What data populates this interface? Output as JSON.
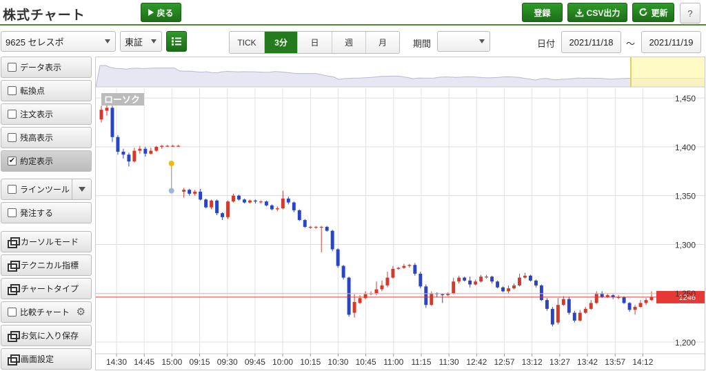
{
  "app": {
    "title": "株式チャート"
  },
  "toolbar": {
    "back_label": "戻る",
    "register_label": "登録",
    "csv_label": "CSV出力",
    "refresh_label": "更新",
    "help_label": "?"
  },
  "controls": {
    "stock_select": "9625 セレスポ",
    "market_select": "東証",
    "timeframes": [
      {
        "label": "TICK",
        "active": false
      },
      {
        "label": "3分",
        "active": true
      },
      {
        "label": "日",
        "active": false
      },
      {
        "label": "週",
        "active": false
      },
      {
        "label": "月",
        "active": false
      }
    ],
    "period_label": "期間",
    "period_value": "",
    "date_label": "日付",
    "date_from": "2021/11/18",
    "date_separator": "～",
    "date_to": "2021/11/19"
  },
  "sidebar": {
    "items": [
      {
        "label": "データ表示",
        "kind": "check",
        "checked": false
      },
      {
        "label": "転換点",
        "kind": "check",
        "checked": false
      },
      {
        "label": "注文表示",
        "kind": "check",
        "checked": false
      },
      {
        "label": "残高表示",
        "kind": "check",
        "checked": false
      },
      {
        "label": "約定表示",
        "kind": "check",
        "checked": true
      },
      {
        "label": "ラインツール",
        "kind": "check-split",
        "checked": false
      },
      {
        "label": "発注する",
        "kind": "check",
        "checked": false
      },
      {
        "label": "カーソルモード",
        "kind": "window"
      },
      {
        "label": "テクニカル指標",
        "kind": "window"
      },
      {
        "label": "チャートタイプ",
        "kind": "window"
      },
      {
        "label": "比較チャート",
        "kind": "check-gear",
        "checked": false
      },
      {
        "label": "お気に入り保存",
        "kind": "window"
      },
      {
        "label": "画面設定",
        "kind": "window"
      }
    ]
  },
  "colors": {
    "accent": "#237b1e",
    "up_candle": "#d33a2c",
    "down_candle": "#2a45c4",
    "price_line": "#e53935",
    "execution_marker": "#f5b800"
  },
  "chart_data": {
    "type": "candlestick",
    "title": "",
    "chart_type_label": "ローソク",
    "current_price_label": "1246",
    "current_price": 1246,
    "ylim": [
      1188,
      1460
    ],
    "y_ticks": [
      "1,450",
      "1,400",
      "1,350",
      "1,300",
      "1,250",
      "1,200"
    ],
    "y_tick_values": [
      1450,
      1400,
      1350,
      1300,
      1250,
      1200
    ],
    "x_ticks": [
      "14:30",
      "14:45",
      "15:00",
      "09:15",
      "09:30",
      "09:45",
      "10:00",
      "10:15",
      "10:30",
      "10:45",
      "11:00",
      "11:15",
      "11:30",
      "12:42",
      "12:57",
      "13:12",
      "13:27",
      "13:42",
      "13:57",
      "14:12"
    ],
    "candles": [
      [
        1428,
        1438,
        1425,
        1442
      ],
      [
        1437,
        1440,
        1432,
        1446
      ],
      [
        1440,
        1410,
        1405,
        1442
      ],
      [
        1410,
        1395,
        1392,
        1412
      ],
      [
        1395,
        1392,
        1388,
        1398
      ],
      [
        1392,
        1385,
        1380,
        1394
      ],
      [
        1385,
        1396,
        1384,
        1399
      ],
      [
        1396,
        1398,
        1393,
        1401
      ],
      [
        1398,
        1393,
        1390,
        1400
      ],
      [
        1393,
        1396,
        1392,
        1399
      ],
      [
        1396,
        1400,
        1395,
        1401
      ],
      [
        1400,
        1401,
        1398,
        1402
      ],
      [
        1401,
        1401,
        1400,
        1402
      ],
      [
        1401,
        1401,
        1400,
        1402
      ],
      [
        1401,
        1401,
        1400,
        1402
      ],
      [
        1354,
        1356,
        1348,
        1358
      ],
      [
        1356,
        1352,
        1350,
        1357
      ],
      [
        1352,
        1354,
        1350,
        1356
      ],
      [
        1354,
        1346,
        1345,
        1357
      ],
      [
        1346,
        1338,
        1337,
        1347
      ],
      [
        1338,
        1345,
        1336,
        1346
      ],
      [
        1345,
        1332,
        1330,
        1346
      ],
      [
        1332,
        1328,
        1325,
        1333
      ],
      [
        1328,
        1344,
        1326,
        1345
      ],
      [
        1344,
        1350,
        1343,
        1352
      ],
      [
        1350,
        1346,
        1345,
        1351
      ],
      [
        1346,
        1343,
        1342,
        1347
      ],
      [
        1343,
        1345,
        1342,
        1346
      ],
      [
        1345,
        1344,
        1342,
        1346
      ],
      [
        1344,
        1344,
        1342,
        1345
      ],
      [
        1344,
        1340,
        1339,
        1345
      ],
      [
        1340,
        1336,
        1335,
        1341
      ],
      [
        1336,
        1337,
        1334,
        1339
      ],
      [
        1337,
        1347,
        1336,
        1355
      ],
      [
        1347,
        1343,
        1341,
        1349
      ],
      [
        1343,
        1335,
        1333,
        1344
      ],
      [
        1335,
        1325,
        1324,
        1336
      ],
      [
        1325,
        1318,
        1317,
        1326
      ],
      [
        1318,
        1318,
        1316,
        1319
      ],
      [
        1318,
        1318,
        1316,
        1319
      ],
      [
        1318,
        1318,
        1292,
        1319
      ],
      [
        1318,
        1314,
        1313,
        1319
      ],
      [
        1314,
        1295,
        1293,
        1315
      ],
      [
        1295,
        1278,
        1276,
        1296
      ],
      [
        1278,
        1266,
        1264,
        1279
      ],
      [
        1266,
        1228,
        1226,
        1267
      ],
      [
        1230,
        1241,
        1225,
        1249
      ],
      [
        1240,
        1245,
        1239,
        1248
      ],
      [
        1245,
        1249,
        1244,
        1252
      ],
      [
        1249,
        1250,
        1248,
        1252
      ],
      [
        1250,
        1254,
        1248,
        1262
      ],
      [
        1254,
        1258,
        1252,
        1263
      ],
      [
        1258,
        1266,
        1256,
        1272
      ],
      [
        1266,
        1275,
        1265,
        1278
      ],
      [
        1275,
        1276,
        1274,
        1277
      ],
      [
        1276,
        1278,
        1275,
        1280
      ],
      [
        1278,
        1279,
        1276,
        1280
      ],
      [
        1279,
        1270,
        1268,
        1281
      ],
      [
        1270,
        1257,
        1255,
        1272
      ],
      [
        1257,
        1238,
        1235,
        1259
      ],
      [
        1238,
        1250,
        1237,
        1252
      ],
      [
        1250,
        1249,
        1246,
        1251
      ],
      [
        1249,
        1248,
        1240,
        1250
      ],
      [
        1248,
        1250,
        1247,
        1251
      ],
      [
        1250,
        1262,
        1249,
        1266
      ],
      [
        1262,
        1266,
        1260,
        1268
      ],
      [
        1266,
        1263,
        1262,
        1267
      ],
      [
        1263,
        1259,
        1256,
        1267
      ],
      [
        1259,
        1262,
        1258,
        1264
      ],
      [
        1262,
        1267,
        1261,
        1269
      ],
      [
        1267,
        1267,
        1265,
        1269
      ],
      [
        1267,
        1262,
        1260,
        1268
      ],
      [
        1262,
        1256,
        1255,
        1263
      ],
      [
        1256,
        1252,
        1251,
        1257
      ],
      [
        1252,
        1255,
        1250,
        1258
      ],
      [
        1255,
        1258,
        1254,
        1260
      ],
      [
        1258,
        1266,
        1257,
        1270
      ],
      [
        1266,
        1268,
        1265,
        1271
      ],
      [
        1268,
        1263,
        1262,
        1269
      ],
      [
        1263,
        1258,
        1256,
        1264
      ],
      [
        1258,
        1243,
        1242,
        1259
      ],
      [
        1243,
        1234,
        1232,
        1245
      ],
      [
        1234,
        1218,
        1216,
        1236
      ],
      [
        1220,
        1238,
        1218,
        1245
      ],
      [
        1238,
        1244,
        1237,
        1247
      ],
      [
        1244,
        1230,
        1228,
        1246
      ],
      [
        1230,
        1222,
        1220,
        1232
      ],
      [
        1222,
        1230,
        1221,
        1233
      ],
      [
        1230,
        1234,
        1229,
        1236
      ],
      [
        1234,
        1240,
        1233,
        1243
      ],
      [
        1240,
        1250,
        1239,
        1252
      ],
      [
        1250,
        1246,
        1245,
        1252
      ],
      [
        1246,
        1248,
        1245,
        1250
      ],
      [
        1248,
        1246,
        1244,
        1249
      ],
      [
        1246,
        1246,
        1244,
        1248
      ],
      [
        1246,
        1240,
        1239,
        1247
      ],
      [
        1240,
        1233,
        1231,
        1241
      ],
      [
        1233,
        1236,
        1228,
        1238
      ],
      [
        1236,
        1240,
        1235,
        1243
      ],
      [
        1240,
        1243,
        1238,
        1245
      ],
      [
        1243,
        1246,
        1242,
        1252
      ]
    ],
    "overview_label": ""
  }
}
